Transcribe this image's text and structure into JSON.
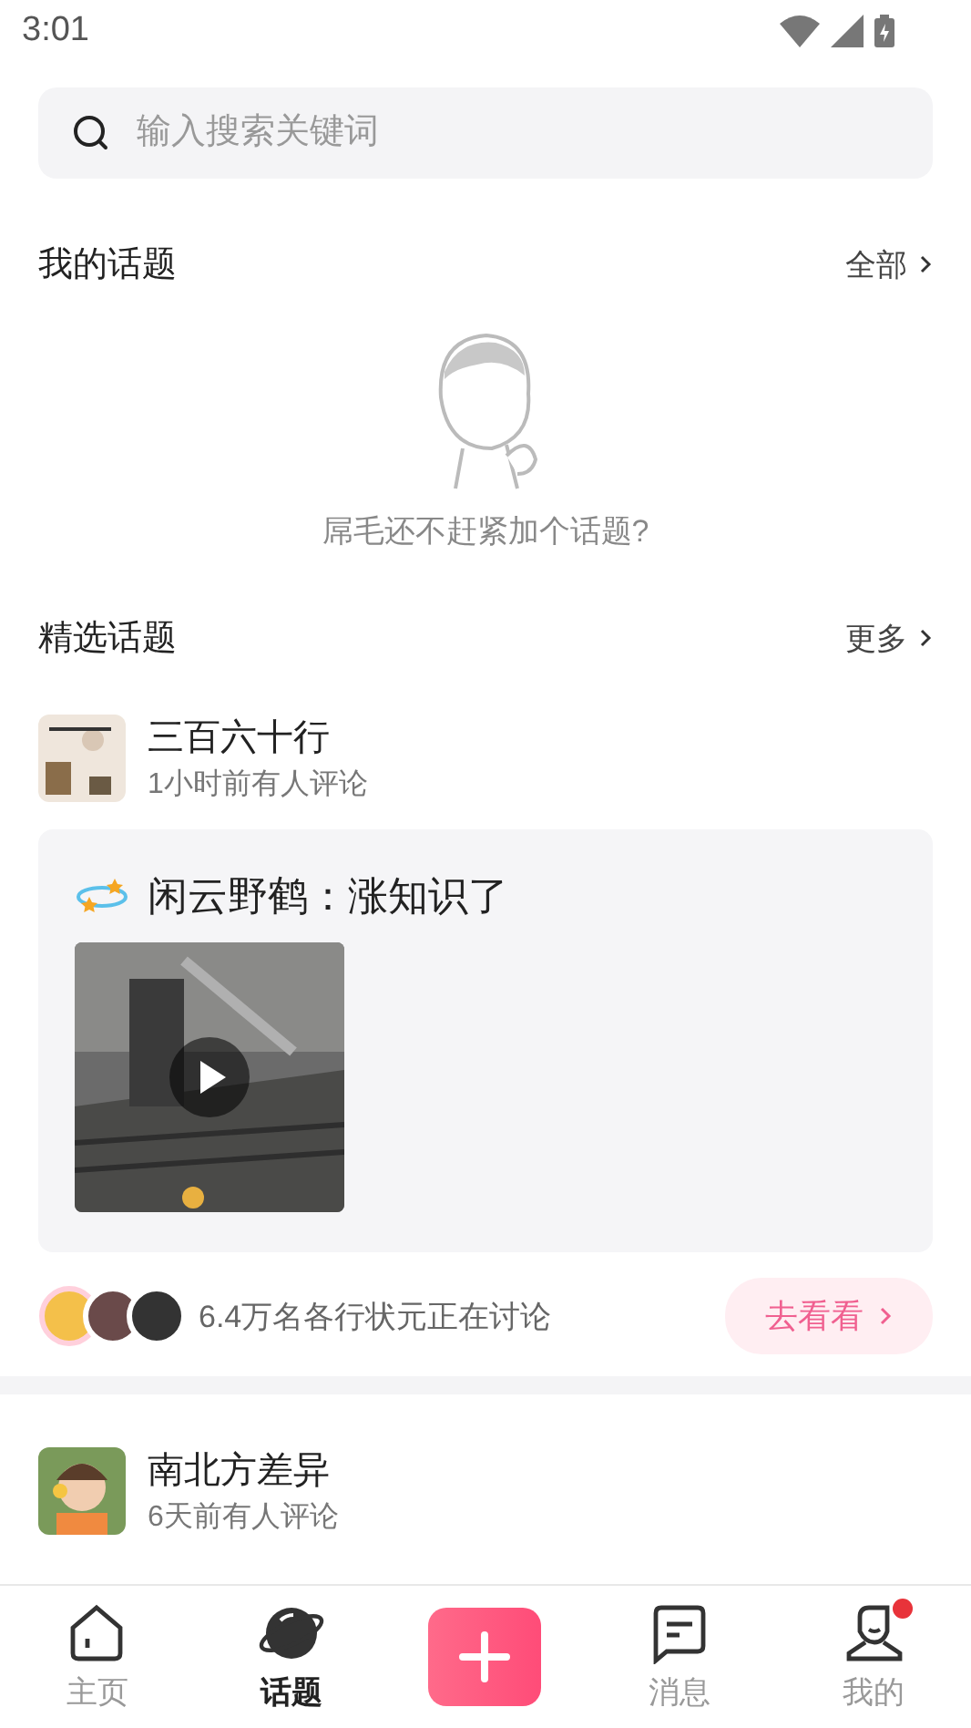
{
  "status_bar": {
    "time": "3:01"
  },
  "search": {
    "placeholder": "输入搜索关键词"
  },
  "my_topics": {
    "title": "我的话题",
    "link": "全部",
    "empty_text": "屌毛还不赶紧加个话题?"
  },
  "featured": {
    "title": "精选话题",
    "link": "更多"
  },
  "topics": [
    {
      "name": "三百六十行",
      "activity": "1小时前有人评论",
      "post": {
        "title": "闲云野鹤：涨知识了",
        "media": {
          "kind": "video"
        }
      },
      "participants": "6.4万名各行状元正在讨论",
      "action": "去看看"
    },
    {
      "name": "南北方差异",
      "activity": "6天前有人评论"
    }
  ],
  "nav": [
    {
      "kind": "tab",
      "label": "主页",
      "selected": false,
      "dot": false
    },
    {
      "kind": "tab",
      "label": "话题",
      "selected": true,
      "dot": false
    },
    {
      "kind": "add"
    },
    {
      "kind": "tab",
      "label": "消息",
      "selected": false,
      "dot": false
    },
    {
      "kind": "tab",
      "label": "我的",
      "selected": false,
      "dot": true
    }
  ]
}
